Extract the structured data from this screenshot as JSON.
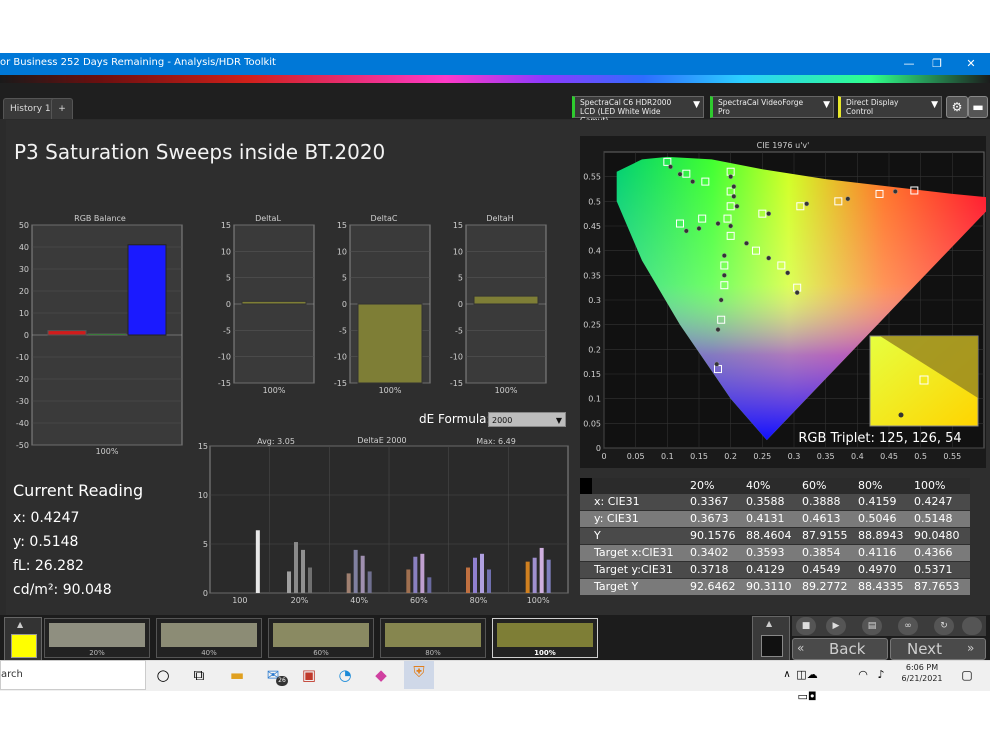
{
  "window": {
    "title": "or Business 252 Days Remaining  - Analysis/HDR Toolkit",
    "minimize": "—",
    "restore": "❐",
    "close": "✕"
  },
  "tabs": [
    {
      "label": "History 1"
    },
    {
      "label": "+"
    }
  ],
  "devices": {
    "meter_line1": "SpectraCal C6 HDR2000",
    "meter_line2": "LCD (LED White Wide Gamut)",
    "generator": "SpectraCal VideoForge Pro",
    "display": "Direct Display Control"
  },
  "page_title": "P3 Saturation Sweeps inside BT.2020",
  "charts": {
    "rgb_balance": {
      "title": "RGB Balance",
      "yticks": [
        "50",
        "40",
        "30",
        "20",
        "10",
        "0",
        "-10",
        "-20",
        "-30",
        "-40",
        "-50"
      ],
      "xlabel": "100%",
      "values": {
        "red": 2,
        "green": 0.5,
        "blue": 41
      },
      "colors": {
        "red": "#d11b1b",
        "green": "#1ea51e",
        "blue": "#1a1aff"
      }
    },
    "deltaL": {
      "title": "DeltaL",
      "yticks": [
        "15",
        "10",
        "5",
        "0",
        "-5",
        "-10",
        "-15"
      ],
      "xlabel": "100%",
      "value": 0.5
    },
    "deltaC": {
      "title": "DeltaC",
      "yticks": [
        "15",
        "10",
        "5",
        "0",
        "-5",
        "-10",
        "-15"
      ],
      "xlabel": "100%",
      "value": -15
    },
    "deltaH": {
      "title": "DeltaH",
      "yticks": [
        "15",
        "10",
        "5",
        "0",
        "-5",
        "-10",
        "-15"
      ],
      "xlabel": "100%",
      "value": 1.5
    },
    "deltaE": {
      "title": "DeltaE 2000",
      "avg": "Avg: 3.05",
      "max": "Max: 6.49",
      "yticks": [
        "15",
        "10",
        "5",
        "0"
      ],
      "xticks": [
        "100",
        "20%",
        "40%",
        "60%",
        "80%",
        "100%"
      ],
      "bars": [
        {
          "group": 0,
          "values": [
            6.4
          ],
          "colors": [
            "#e8e8e8"
          ]
        },
        {
          "group": 1,
          "values": [
            2.2,
            5.2,
            4.4,
            2.6
          ],
          "colors": [
            "#a0a0a0",
            "#8a8a8a",
            "#909090",
            "#707070"
          ]
        },
        {
          "group": 2,
          "values": [
            2.0,
            4.4,
            3.8,
            2.2
          ],
          "colors": [
            "#a08070",
            "#8080a0",
            "#a090b0",
            "#707090"
          ]
        },
        {
          "group": 3,
          "values": [
            2.4,
            3.7,
            4.0,
            1.6
          ],
          "colors": [
            "#a07050",
            "#8a80c0",
            "#c0a0d0",
            "#6a6aa0"
          ]
        },
        {
          "group": 4,
          "values": [
            2.6,
            3.6,
            4.0,
            2.4
          ],
          "colors": [
            "#c07040",
            "#9080d0",
            "#b0a0e0",
            "#7070b0"
          ]
        },
        {
          "group": 5,
          "values": [
            3.2,
            3.6,
            4.6,
            3.4
          ],
          "colors": [
            "#d08020",
            "#a090d0",
            "#d0b0e0",
            "#8080c0"
          ]
        }
      ]
    },
    "cie": {
      "title": "CIE 1976 u'v'",
      "xticks": [
        "0",
        "0.05",
        "0.1",
        "0.15",
        "0.2",
        "0.25",
        "0.3",
        "0.35",
        "0.4",
        "0.45",
        "0.5",
        "0.55"
      ],
      "yticks": [
        "0.55",
        "0.5",
        "0.45",
        "0.4",
        "0.35",
        "0.3",
        "0.25",
        "0.2",
        "0.15",
        "0.1",
        "0.05",
        "0"
      ],
      "rgb_triplet": "RGB Triplet: 125, 126, 54"
    }
  },
  "de_formula": {
    "label": "dE Formula:",
    "value": "2000"
  },
  "current_reading": {
    "title": "Current Reading",
    "x": "x: 0.4247",
    "y": "y: 0.5148",
    "fl": "fL: 26.282",
    "cd": "cd/m²: 90.048"
  },
  "table": {
    "headers": [
      "",
      "20%",
      "40%",
      "60%",
      "80%",
      "100%"
    ],
    "rows": [
      {
        "label": "x: CIE31",
        "values": [
          "0.3367",
          "0.3588",
          "0.3888",
          "0.4159",
          "0.4247"
        ]
      },
      {
        "label": "y: CIE31",
        "values": [
          "0.3673",
          "0.4131",
          "0.4613",
          "0.5046",
          "0.5148"
        ]
      },
      {
        "label": "Y",
        "values": [
          "90.1576",
          "88.4604",
          "87.9155",
          "88.8943",
          "90.0480"
        ]
      },
      {
        "label": "Target x:CIE31",
        "values": [
          "0.3402",
          "0.3593",
          "0.3854",
          "0.4116",
          "0.4366"
        ]
      },
      {
        "label": "Target y:CIE31",
        "values": [
          "0.3718",
          "0.4129",
          "0.4549",
          "0.4970",
          "0.5371"
        ]
      },
      {
        "label": "Target Y",
        "values": [
          "92.6462",
          "90.3110",
          "89.2772",
          "88.4335",
          "87.7653"
        ]
      }
    ]
  },
  "swatches": [
    {
      "label": "20%",
      "color": "#8f8f80"
    },
    {
      "label": "40%",
      "color": "#8c8c75"
    },
    {
      "label": "60%",
      "color": "#8a8a62"
    },
    {
      "label": "80%",
      "color": "#86864f"
    },
    {
      "label": "100%",
      "color": "#7e7e36"
    }
  ],
  "nav": {
    "back": "Back",
    "next": "Next"
  },
  "taskbar": {
    "search_placeholder": "arch",
    "time": "6:06 PM",
    "date": "6/21/2021",
    "mail_badge": "26"
  }
}
